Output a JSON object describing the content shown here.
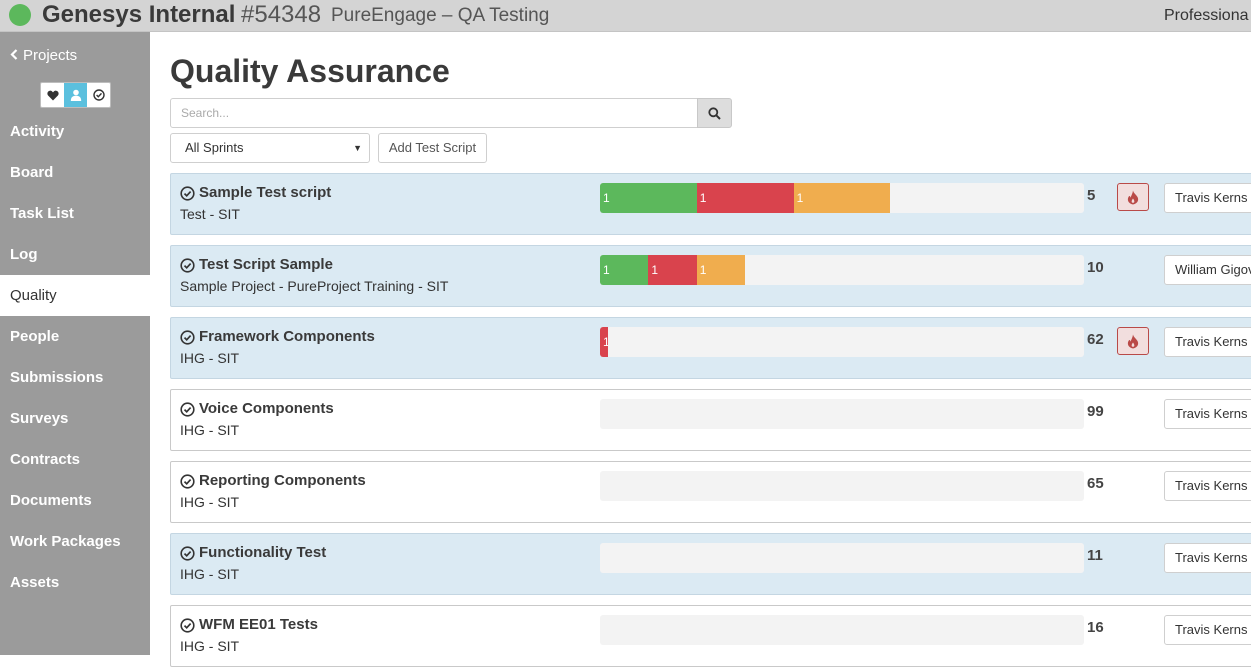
{
  "header": {
    "company": "Genesys Internal",
    "project_number": "#54348",
    "project_name": "PureEngage – QA Testing",
    "right_text": "Professiona",
    "status_color": "#5cb85c"
  },
  "sidebar": {
    "back_label": "Projects",
    "icon_toggles": [
      "heart-icon",
      "user-icon",
      "check-circle-icon"
    ],
    "items": [
      {
        "label": "Activity"
      },
      {
        "label": "Board"
      },
      {
        "label": "Task List"
      },
      {
        "label": "Log"
      },
      {
        "label": "Quality",
        "active": true
      },
      {
        "label": "People"
      },
      {
        "label": "Submissions"
      },
      {
        "label": "Surveys"
      },
      {
        "label": "Contracts"
      },
      {
        "label": "Documents"
      },
      {
        "label": "Work Packages"
      },
      {
        "label": "Assets"
      }
    ]
  },
  "main": {
    "title": "Quality Assurance",
    "search_placeholder": "Search...",
    "sprint_filter": "All Sprints",
    "add_button": "Add Test Script"
  },
  "colors": {
    "passed": "#5cb85c",
    "failed": "#d9434d",
    "pending": "#f0ad4e",
    "row_highlight": "#dbeaf3"
  },
  "scripts": [
    {
      "title": "Sample Test script",
      "subtitle": "Test - SIT",
      "count": "5",
      "alert": true,
      "assignee": "Travis Kerns",
      "highlight": true,
      "segments": [
        {
          "status": "passed",
          "label": "1",
          "fraction": 0.2
        },
        {
          "status": "failed",
          "label": "1",
          "fraction": 0.2
        },
        {
          "status": "pending",
          "label": "1",
          "fraction": 0.2
        }
      ]
    },
    {
      "title": "Test Script Sample",
      "subtitle": "Sample Project - PureProject Training - SIT",
      "count": "10",
      "alert": false,
      "assignee": "William Gigov",
      "highlight": true,
      "segments": [
        {
          "status": "passed",
          "label": "1",
          "fraction": 0.1
        },
        {
          "status": "failed",
          "label": "1",
          "fraction": 0.1
        },
        {
          "status": "pending",
          "label": "1",
          "fraction": 0.1
        }
      ]
    },
    {
      "title": "Framework Components",
      "subtitle": "IHG - SIT",
      "count": "62",
      "alert": true,
      "assignee": "Travis Kerns",
      "highlight": true,
      "segments": [
        {
          "status": "failed",
          "label": "1",
          "fraction": 0.016
        }
      ]
    },
    {
      "title": "Voice Components",
      "subtitle": "IHG - SIT",
      "count": "99",
      "alert": false,
      "assignee": "Travis Kerns",
      "highlight": false,
      "segments": []
    },
    {
      "title": "Reporting Components",
      "subtitle": "IHG - SIT",
      "count": "65",
      "alert": false,
      "assignee": "Travis Kerns",
      "highlight": false,
      "segments": []
    },
    {
      "title": "Functionality Test",
      "subtitle": "IHG - SIT",
      "count": "11",
      "alert": false,
      "assignee": "Travis Kerns",
      "highlight": true,
      "segments": []
    },
    {
      "title": "WFM EE01 Tests",
      "subtitle": "IHG - SIT",
      "count": "16",
      "alert": false,
      "assignee": "Travis Kerns",
      "highlight": false,
      "segments": []
    }
  ]
}
